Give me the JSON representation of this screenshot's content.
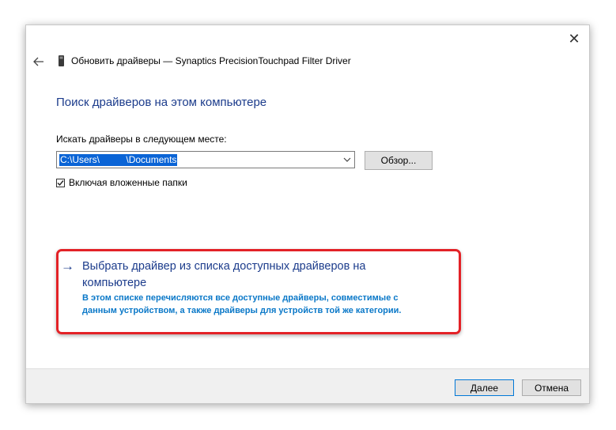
{
  "window": {
    "title": "Обновить драйверы — Synaptics PrecisionTouchpad Filter Driver",
    "close_glyph": "✕"
  },
  "main": {
    "heading": "Поиск драйверов на этом компьютере",
    "search_label": "Искать драйверы в следующем месте:",
    "path_value": "C:\\Users\\     \\Documents",
    "browse_label": "Обзор...",
    "include_subfolders_label": "Включая вложенные папки",
    "include_subfolders_checked": true
  },
  "option": {
    "arrow": "→",
    "title": "Выбрать драйвер из списка доступных драйверов на компьютере",
    "description": "В этом списке перечисляются все доступные драйверы, совместимые с данным устройством, а также драйверы для устройств той же категории."
  },
  "footer": {
    "next_label": "Далее",
    "cancel_label": "Отмена"
  },
  "colors": {
    "heading": "#1c3c8c",
    "description": "#0a78c8",
    "highlight": "#e32227",
    "selection": "#0a64d6"
  },
  "icons": [
    "close-icon",
    "back-arrow-icon",
    "device-icon",
    "chevron-down-icon",
    "checkmark-icon",
    "arrow-right-icon"
  ]
}
